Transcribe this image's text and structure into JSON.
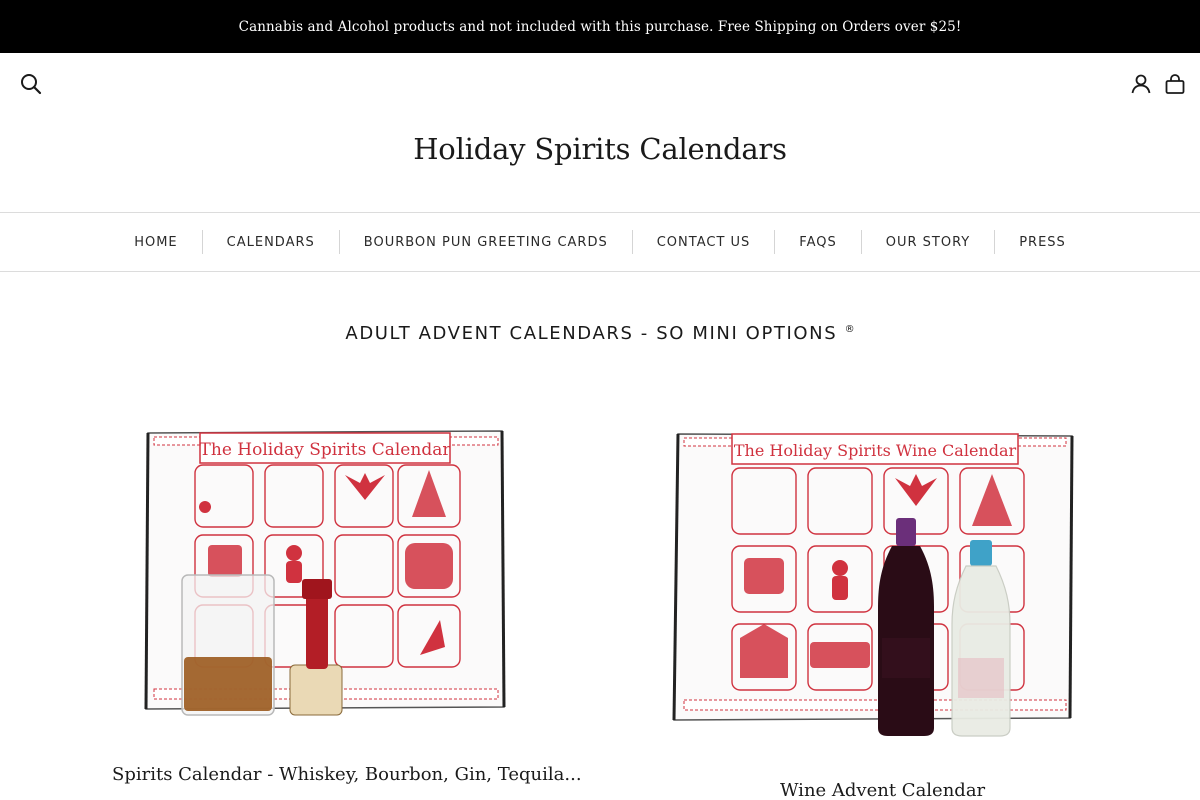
{
  "announcement": {
    "text": "Cannabis and Alcohol products and not included with this purchase. Free Shipping on Orders over $25!"
  },
  "header": {
    "site_title": "Holiday Spirits Calendars",
    "icons": {
      "search": "search-icon",
      "account": "account-icon",
      "cart": "cart-icon"
    }
  },
  "nav": {
    "items": [
      {
        "label": "HOME"
      },
      {
        "label": "CALENDARS"
      },
      {
        "label": "BOURBON PUN GREETING CARDS"
      },
      {
        "label": "CONTACT US"
      },
      {
        "label": "FAQS"
      },
      {
        "label": "OUR STORY"
      },
      {
        "label": "PRESS"
      }
    ]
  },
  "section": {
    "heading": "ADULT ADVENT CALENDARS - SO MINI OPTIONS",
    "heading_mark": "®"
  },
  "products": [
    {
      "title": "Spirits Calendar - Whiskey, Bourbon, Gin, Tequila...",
      "image_banner": "The Holiday Spirits Calendar"
    },
    {
      "title": "Wine Advent Calendar",
      "image_banner": "The Holiday Spirits Wine Calendar"
    }
  ],
  "colors": {
    "announcement_bg": "#000000",
    "accent_red": "#d0323f",
    "text": "#1a1a1a",
    "divider": "#dcdcdc"
  }
}
